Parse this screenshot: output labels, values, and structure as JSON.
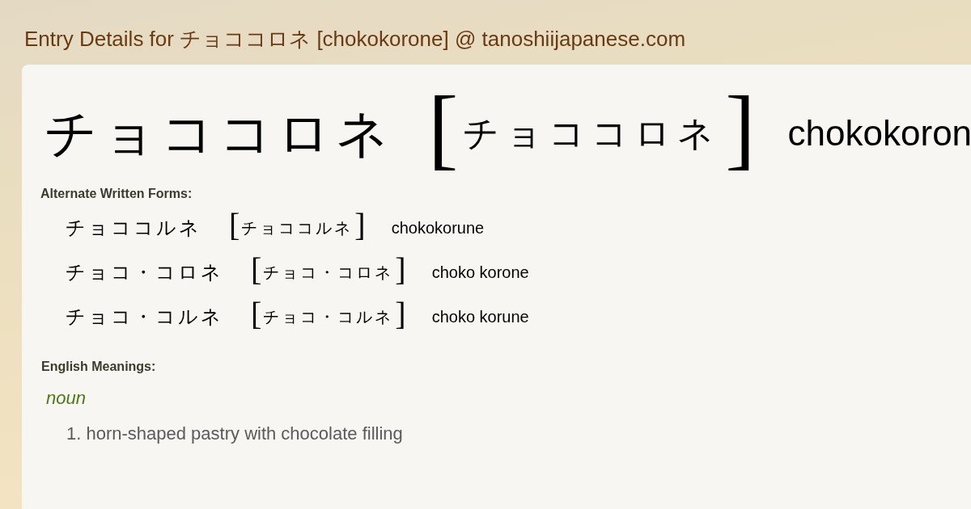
{
  "page_title": "Entry Details for チョココロネ [chokokorone] @ tanoshiijapanese.com",
  "entry": {
    "headword": "チョココロネ",
    "reading": {
      "open": "[",
      "text": "チョココロネ",
      "close": "]"
    },
    "romaji": "chokokoron"
  },
  "alternate_forms": {
    "heading": "Alternate Written Forms:",
    "items": [
      {
        "written": "チョココルネ",
        "reading": {
          "open": "[",
          "text": "チョココルネ",
          "close": "]"
        },
        "romaji": "chokokorune"
      },
      {
        "written": "チョコ・コロネ",
        "reading": {
          "open": "[",
          "text": "チョコ・コロネ",
          "close": "]"
        },
        "romaji": "choko korone"
      },
      {
        "written": "チョコ・コルネ",
        "reading": {
          "open": "[",
          "text": "チョコ・コルネ",
          "close": "]"
        },
        "romaji": "choko korune"
      }
    ]
  },
  "meanings": {
    "heading": "English Meanings:",
    "groups": [
      {
        "part_of_speech": "noun",
        "senses": [
          "1. horn-shaped pastry with chocolate filling"
        ]
      }
    ]
  }
}
